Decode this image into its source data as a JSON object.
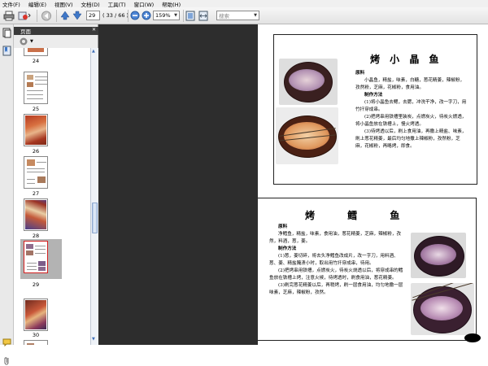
{
  "menu": {
    "items": [
      "文件(F)",
      "编辑(E)",
      "视图(V)",
      "文档(D)",
      "工具(T)",
      "窗口(W)",
      "帮助(H)"
    ]
  },
  "toolbar": {
    "page_number": "29",
    "page_total": "( 33 / 66 )",
    "zoom": "159%",
    "search_placeholder": "搜索"
  },
  "panel": {
    "title": "页面",
    "thumbnails": [
      {
        "label": "24",
        "selected": false
      },
      {
        "label": "25",
        "selected": false
      },
      {
        "label": "26",
        "selected": false
      },
      {
        "label": "27",
        "selected": false
      },
      {
        "label": "28",
        "selected": false
      },
      {
        "label": "29",
        "selected": true
      },
      {
        "label": "30",
        "selected": false
      }
    ]
  },
  "page": {
    "recipe1": {
      "title": "烤 小 晶 鱼",
      "ingredients_heading": "原料",
      "ingredients": "小晶鱼，精盐，味素，白糖，葱花精姜，辣椒粉，孜然粉，芝麻，花椒粉，食用油。",
      "method_heading": "制作方法",
      "steps": [
        "(1)将小晶鱼去鳃，去腮，冲洗干净，改一字刀，用竹扦穿成串。",
        "(2)把烤串用铁槽里装炭，点燃炭火，待炭火燃透，将小晶鱼放在铁槽上，慢火烤透。",
        "(3)待烤透以后，刷上食用油，再撒上精盐、味素，刷上葱花精姜，最后均匀地撒上辣椒粉，孜然粉，芝麻，花椒粉，再略烤，即食。"
      ]
    },
    "recipe2": {
      "title": "烤 鳕 鱼",
      "ingredients_heading": "原料",
      "ingredients": "净鳕鱼，精盐，味素，食用油，葱花精姜，芝麻，辣椒粉，孜然，料酒，葱，姜。",
      "method_heading": "制作方法",
      "steps": [
        "(1)葱，姜切碎，将去头净鳕鱼改成片，改一字刀，用料酒、葱、姜、精盐腌渍小时，取出用竹扦穿成串，待用。",
        "(2)把烤串用铁槽，点燃炭火，待炭火烧透以后，将穿成串的鳕鱼放在铁槽上烤，注意火候，待烤透时，刷食用油，葱花精姜。",
        "(3)刷完葱花精姜以后，再稍烤，刷一层食用油，均匀地撒一层味素，芝麻，辣椒粉，孜然。"
      ]
    }
  },
  "colors": {
    "dark_view": "#2d2d2d",
    "panel_header": "#3a3a3a",
    "selected_thumb": "#b3b3b3"
  }
}
